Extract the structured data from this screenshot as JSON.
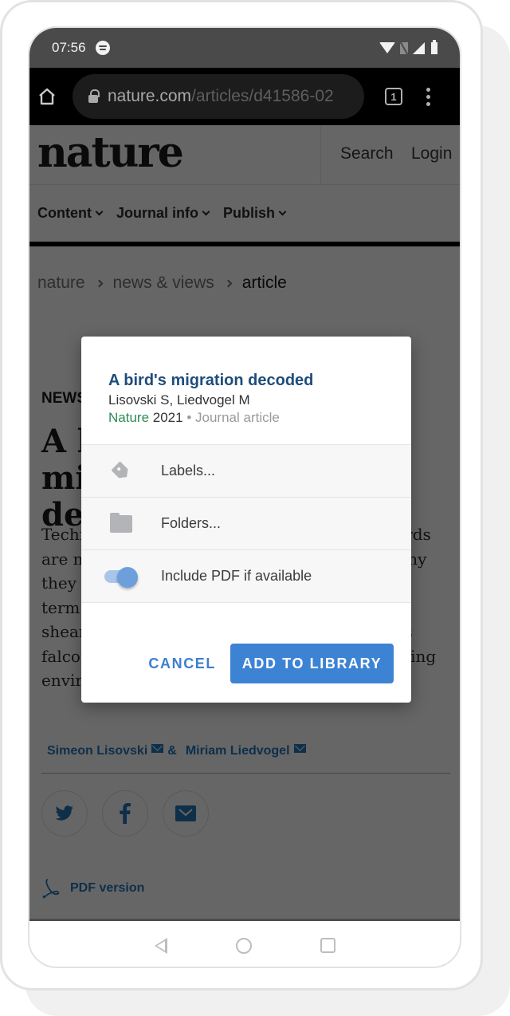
{
  "status_bar": {
    "time": "07:56",
    "icons": [
      "spotify-icon",
      "wifi-icon",
      "no-sim-icon",
      "signal-icon",
      "battery-icon"
    ]
  },
  "browser": {
    "url_host": "nature.com",
    "url_path": "/articles/d41586-02",
    "tab_count": "1"
  },
  "site": {
    "logo": "nature",
    "search_label": "Search",
    "login_label": "Login",
    "nav": [
      {
        "label": "Content"
      },
      {
        "label": "Journal info"
      },
      {
        "label": "Publish"
      }
    ],
    "breadcrumb": [
      "nature",
      "news & views",
      "article"
    ]
  },
  "article": {
    "type": "NEWS & VIEWS",
    "title": "A bird's migration decoded",
    "standfirst": "Technologies that are enabling tracking of birds are now being used to investigate how and why they migrate. An analysis of changes in long-term wind conditions that affect migration in shearwaters provides clues to how Eleonora's falcons and other birds cope with their changing environment of future climate change.",
    "authors": [
      {
        "name": "Simeon Lisovski"
      },
      {
        "name": "Miriam Liedvogel"
      }
    ],
    "author_separator": "&",
    "pdf_label": "PDF version"
  },
  "dialog": {
    "item_title": "A bird's migration decoded",
    "item_authors": "Lisovski S, Liedvogel M",
    "item_publication": "Nature",
    "item_year": "2021",
    "item_separator": "•",
    "item_type": "Journal article",
    "labels_label": "Labels...",
    "folders_label": "Folders...",
    "include_pdf_label": "Include PDF if available",
    "include_pdf_enabled": true,
    "cancel_label": "CANCEL",
    "add_label": "ADD TO LIBRARY",
    "accent_color": "#3d83d4"
  }
}
